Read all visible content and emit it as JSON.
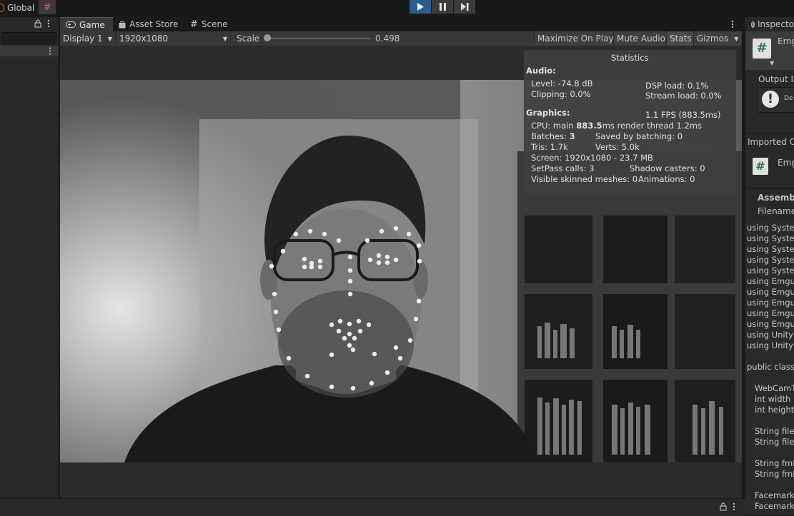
{
  "topbar": {
    "global_label": "Global",
    "play_icon": "play-icon",
    "pause_icon": "pause-icon",
    "step_icon": "step-icon"
  },
  "game": {
    "tabs": [
      {
        "label": "Game",
        "icon": "gamepad-icon"
      },
      {
        "label": "Asset Store",
        "icon": "bag-icon"
      },
      {
        "label": "Scene",
        "icon": "grid-icon"
      }
    ],
    "toolbar": {
      "display": "Display 1",
      "resolution": "1920x1080",
      "scale_label": "Scale",
      "scale_value": "0.498",
      "scale_fraction": 0.0,
      "maximize": "Maximize On Play",
      "mute": "Mute Audio",
      "stats": "Stats",
      "gizmos": "Gizmos"
    }
  },
  "stats": {
    "title": "Statistics",
    "audio_header": "Audio:",
    "level": "Level: -74.8 dB",
    "dsp": "DSP load: 0.1%",
    "clipping": "Clipping: 0.0%",
    "stream": "Stream load: 0.0%",
    "graphics_header": "Graphics:",
    "fps": "1.1 FPS (883.5ms)",
    "cpu_prefix": "CPU: main ",
    "cpu_main": "883.5",
    "cpu_suffix": "ms  render thread 1.2ms",
    "batches_prefix": "Batches: ",
    "batches": "3",
    "saved": "Saved by batching: 0",
    "tris": "Tris: 1.7k",
    "verts": "Verts: 5.0k",
    "screen": "Screen: 1920x1080 - 23.7 MB",
    "setpass": "SetPass calls: 3",
    "shadow": "Shadow casters: 0",
    "skinned": "Visible skinned meshes: 0",
    "animations": "Animations: 0"
  },
  "inspector": {
    "tab": "Inspecto",
    "asset_name": "Emg",
    "output_label": "Output In",
    "warning_text": "De",
    "imported_label": "Imported Ob",
    "imported_name": "Emg",
    "assembly": "Assemb",
    "filename": "Filename",
    "code_lines": [
      "using Syste",
      "using Syste",
      "using Syste",
      "using Syste",
      "using Syste",
      "using Emgu.",
      "using Emgu.",
      "using Emgu.",
      "using Emgu.",
      "using Emgu.",
      "using UnityE",
      "using UnityE",
      "",
      "public class",
      "",
      "  WebCamT",
      "  int width =",
      "  int height",
      "",
      "  String file",
      "  String file",
      "",
      "  String fmF",
      "  String fmF",
      "",
      "  Facemark",
      "  Facemark"
    ]
  },
  "colors": {
    "accent": "#2a5c8e",
    "panel": "#282828",
    "toolbar": "#383838",
    "landmark": "#e8e8e8"
  }
}
